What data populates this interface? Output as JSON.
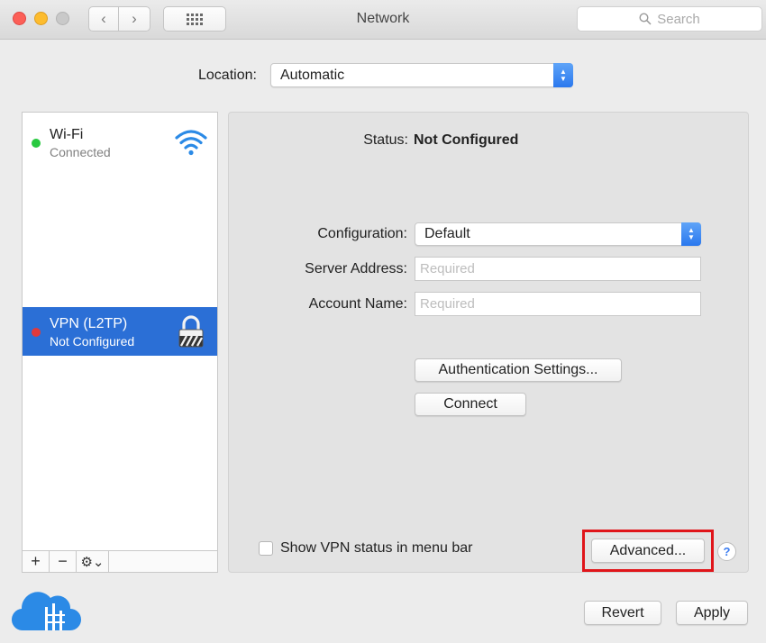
{
  "window": {
    "title": "Network",
    "search_placeholder": "Search"
  },
  "location": {
    "label": "Location:",
    "value": "Automatic"
  },
  "services": [
    {
      "name": "Wi-Fi",
      "status": "Connected",
      "status_color": "#28c940",
      "icon": "wifi-icon"
    },
    {
      "name": "VPN (L2TP)",
      "status": "Not Configured",
      "status_color": "#e0393c",
      "icon": "lock-icon",
      "selected": true
    }
  ],
  "sidebar_toolbar": {
    "add": "+",
    "remove": "−",
    "action": "⚙︎⌄"
  },
  "detail": {
    "status_label": "Status:",
    "status_value": "Not Configured",
    "configuration_label": "Configuration:",
    "configuration_value": "Default",
    "server_label": "Server Address:",
    "server_placeholder": "Required",
    "account_label": "Account Name:",
    "account_placeholder": "Required",
    "auth_button": "Authentication Settings...",
    "connect_button": "Connect",
    "show_vpn_label": "Show VPN status in menu bar",
    "advanced_button": "Advanced...",
    "help": "?"
  },
  "footer": {
    "revert_button": "Revert",
    "apply_button": "Apply"
  },
  "colors": {
    "accent": "#2b6fd6",
    "highlight_box": "#e0151a"
  }
}
